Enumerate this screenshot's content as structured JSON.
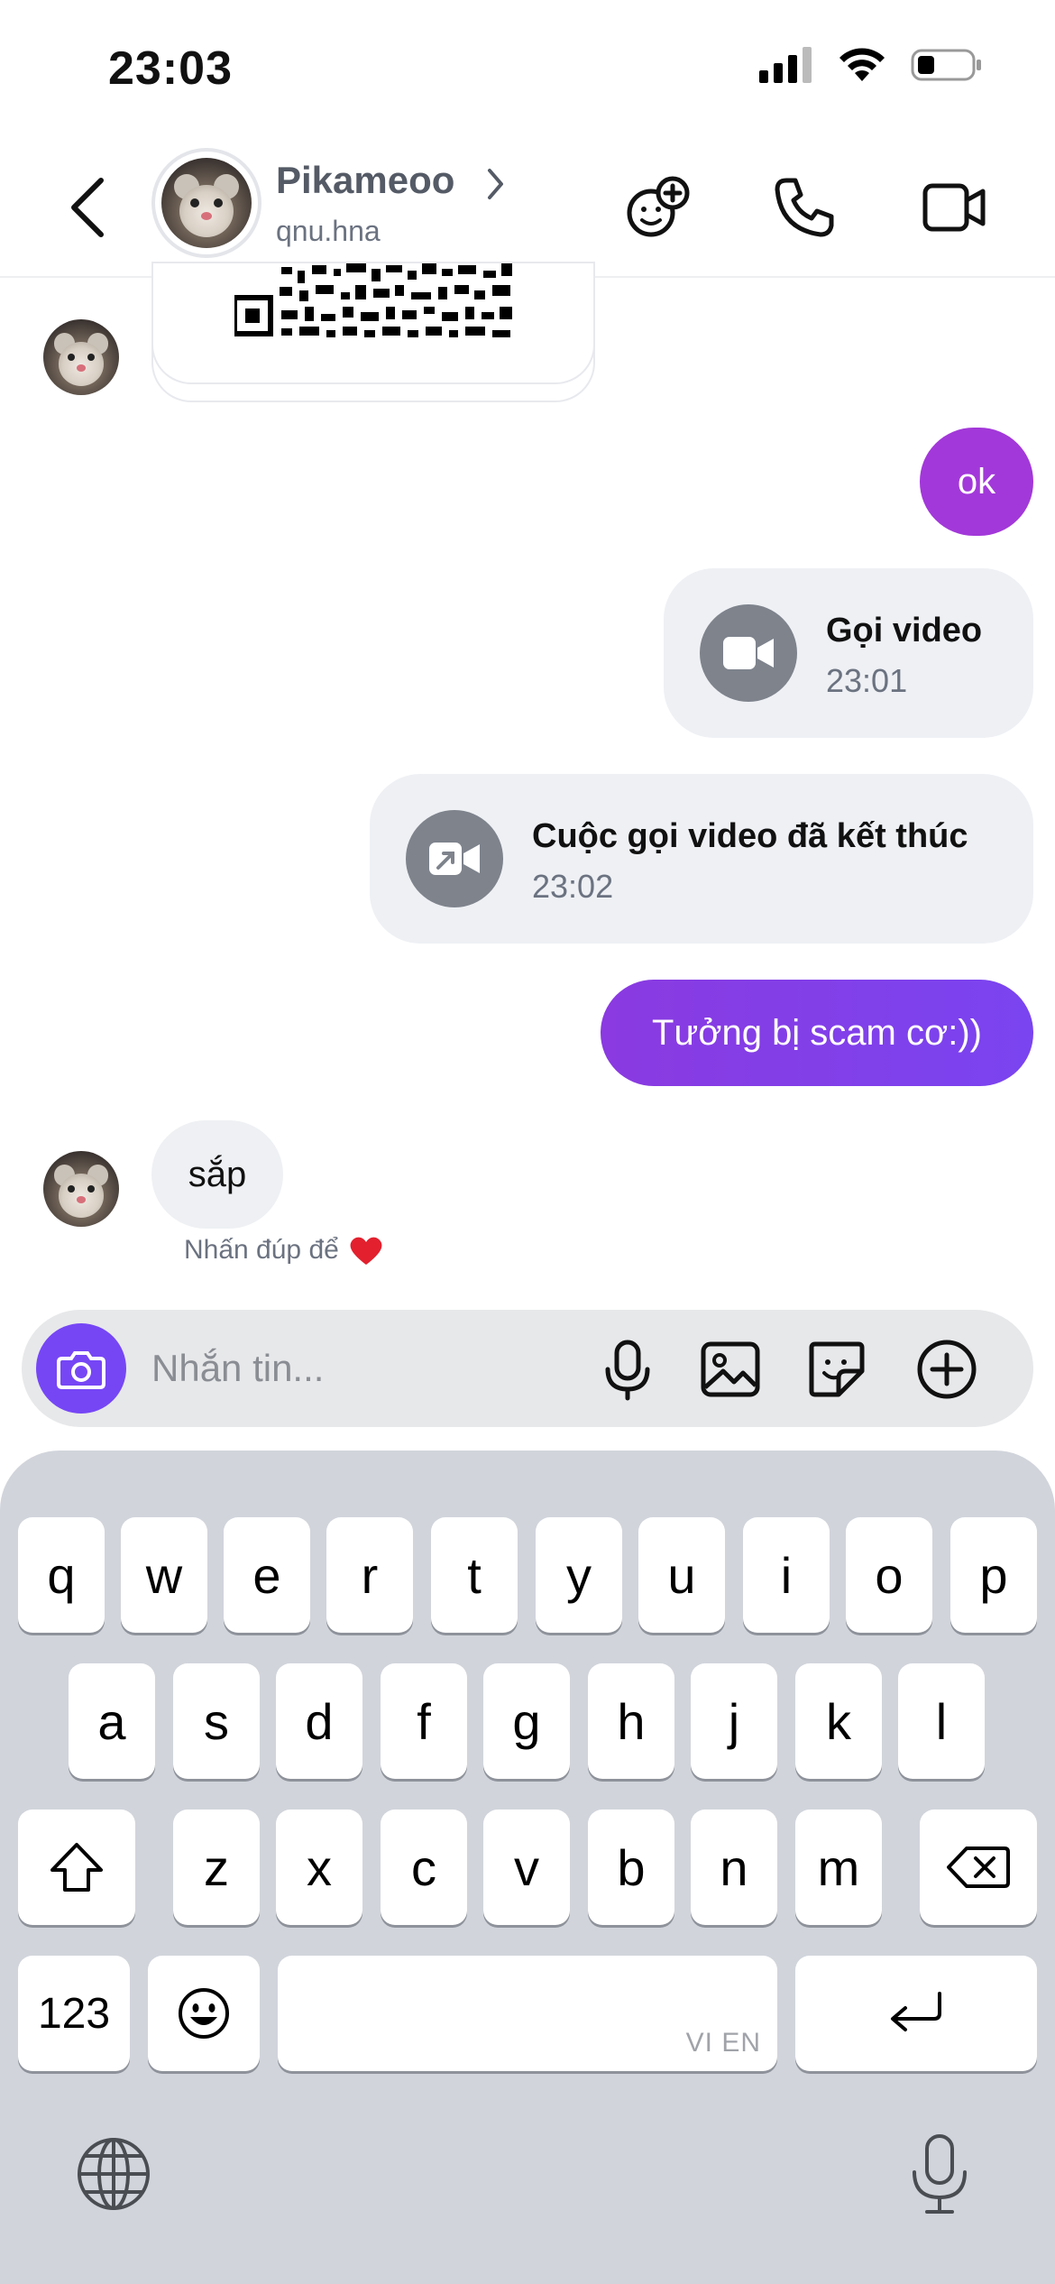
{
  "status_bar": {
    "time": "23:03"
  },
  "header": {
    "name": "Pikameoo",
    "handle": "qnu.hna"
  },
  "messages": {
    "out_ok": "ok",
    "call_1": {
      "title": "Gọi video",
      "time": "23:01"
    },
    "call_2": {
      "title": "Cuộc gọi video đã kết thúc",
      "time": "23:02"
    },
    "out_scam": "Tưởng bị scam cơ:))",
    "in_sap": "sắp",
    "hint_text": "Nhấn đúp để",
    "hint_emoji": "❤️"
  },
  "composer": {
    "placeholder": "Nhắn tin..."
  },
  "keyboard": {
    "row1": [
      "q",
      "w",
      "e",
      "r",
      "t",
      "y",
      "u",
      "i",
      "o",
      "p"
    ],
    "row2": [
      "a",
      "s",
      "d",
      "f",
      "g",
      "h",
      "j",
      "k",
      "l"
    ],
    "row3": [
      "z",
      "x",
      "c",
      "v",
      "b",
      "n",
      "m"
    ],
    "numbers_label": "123",
    "space_lang": "VI EN"
  },
  "colors": {
    "accent_purple": "#7646f5",
    "bubble_ok": "#a238d9",
    "bubble_scam_start": "#8a3ae0",
    "bubble_scam_end": "#7a44f0"
  },
  "icons": {
    "header": [
      "back-chevron-icon",
      "add-effect-icon",
      "phone-icon",
      "video-camera-icon"
    ],
    "composer": [
      "camera-icon",
      "microphone-icon",
      "gallery-icon",
      "sticker-icon",
      "plus-circle-icon"
    ],
    "keyboard": [
      "shift-icon",
      "backspace-icon",
      "emoji-icon",
      "return-icon",
      "globe-icon",
      "dictation-icon"
    ]
  }
}
